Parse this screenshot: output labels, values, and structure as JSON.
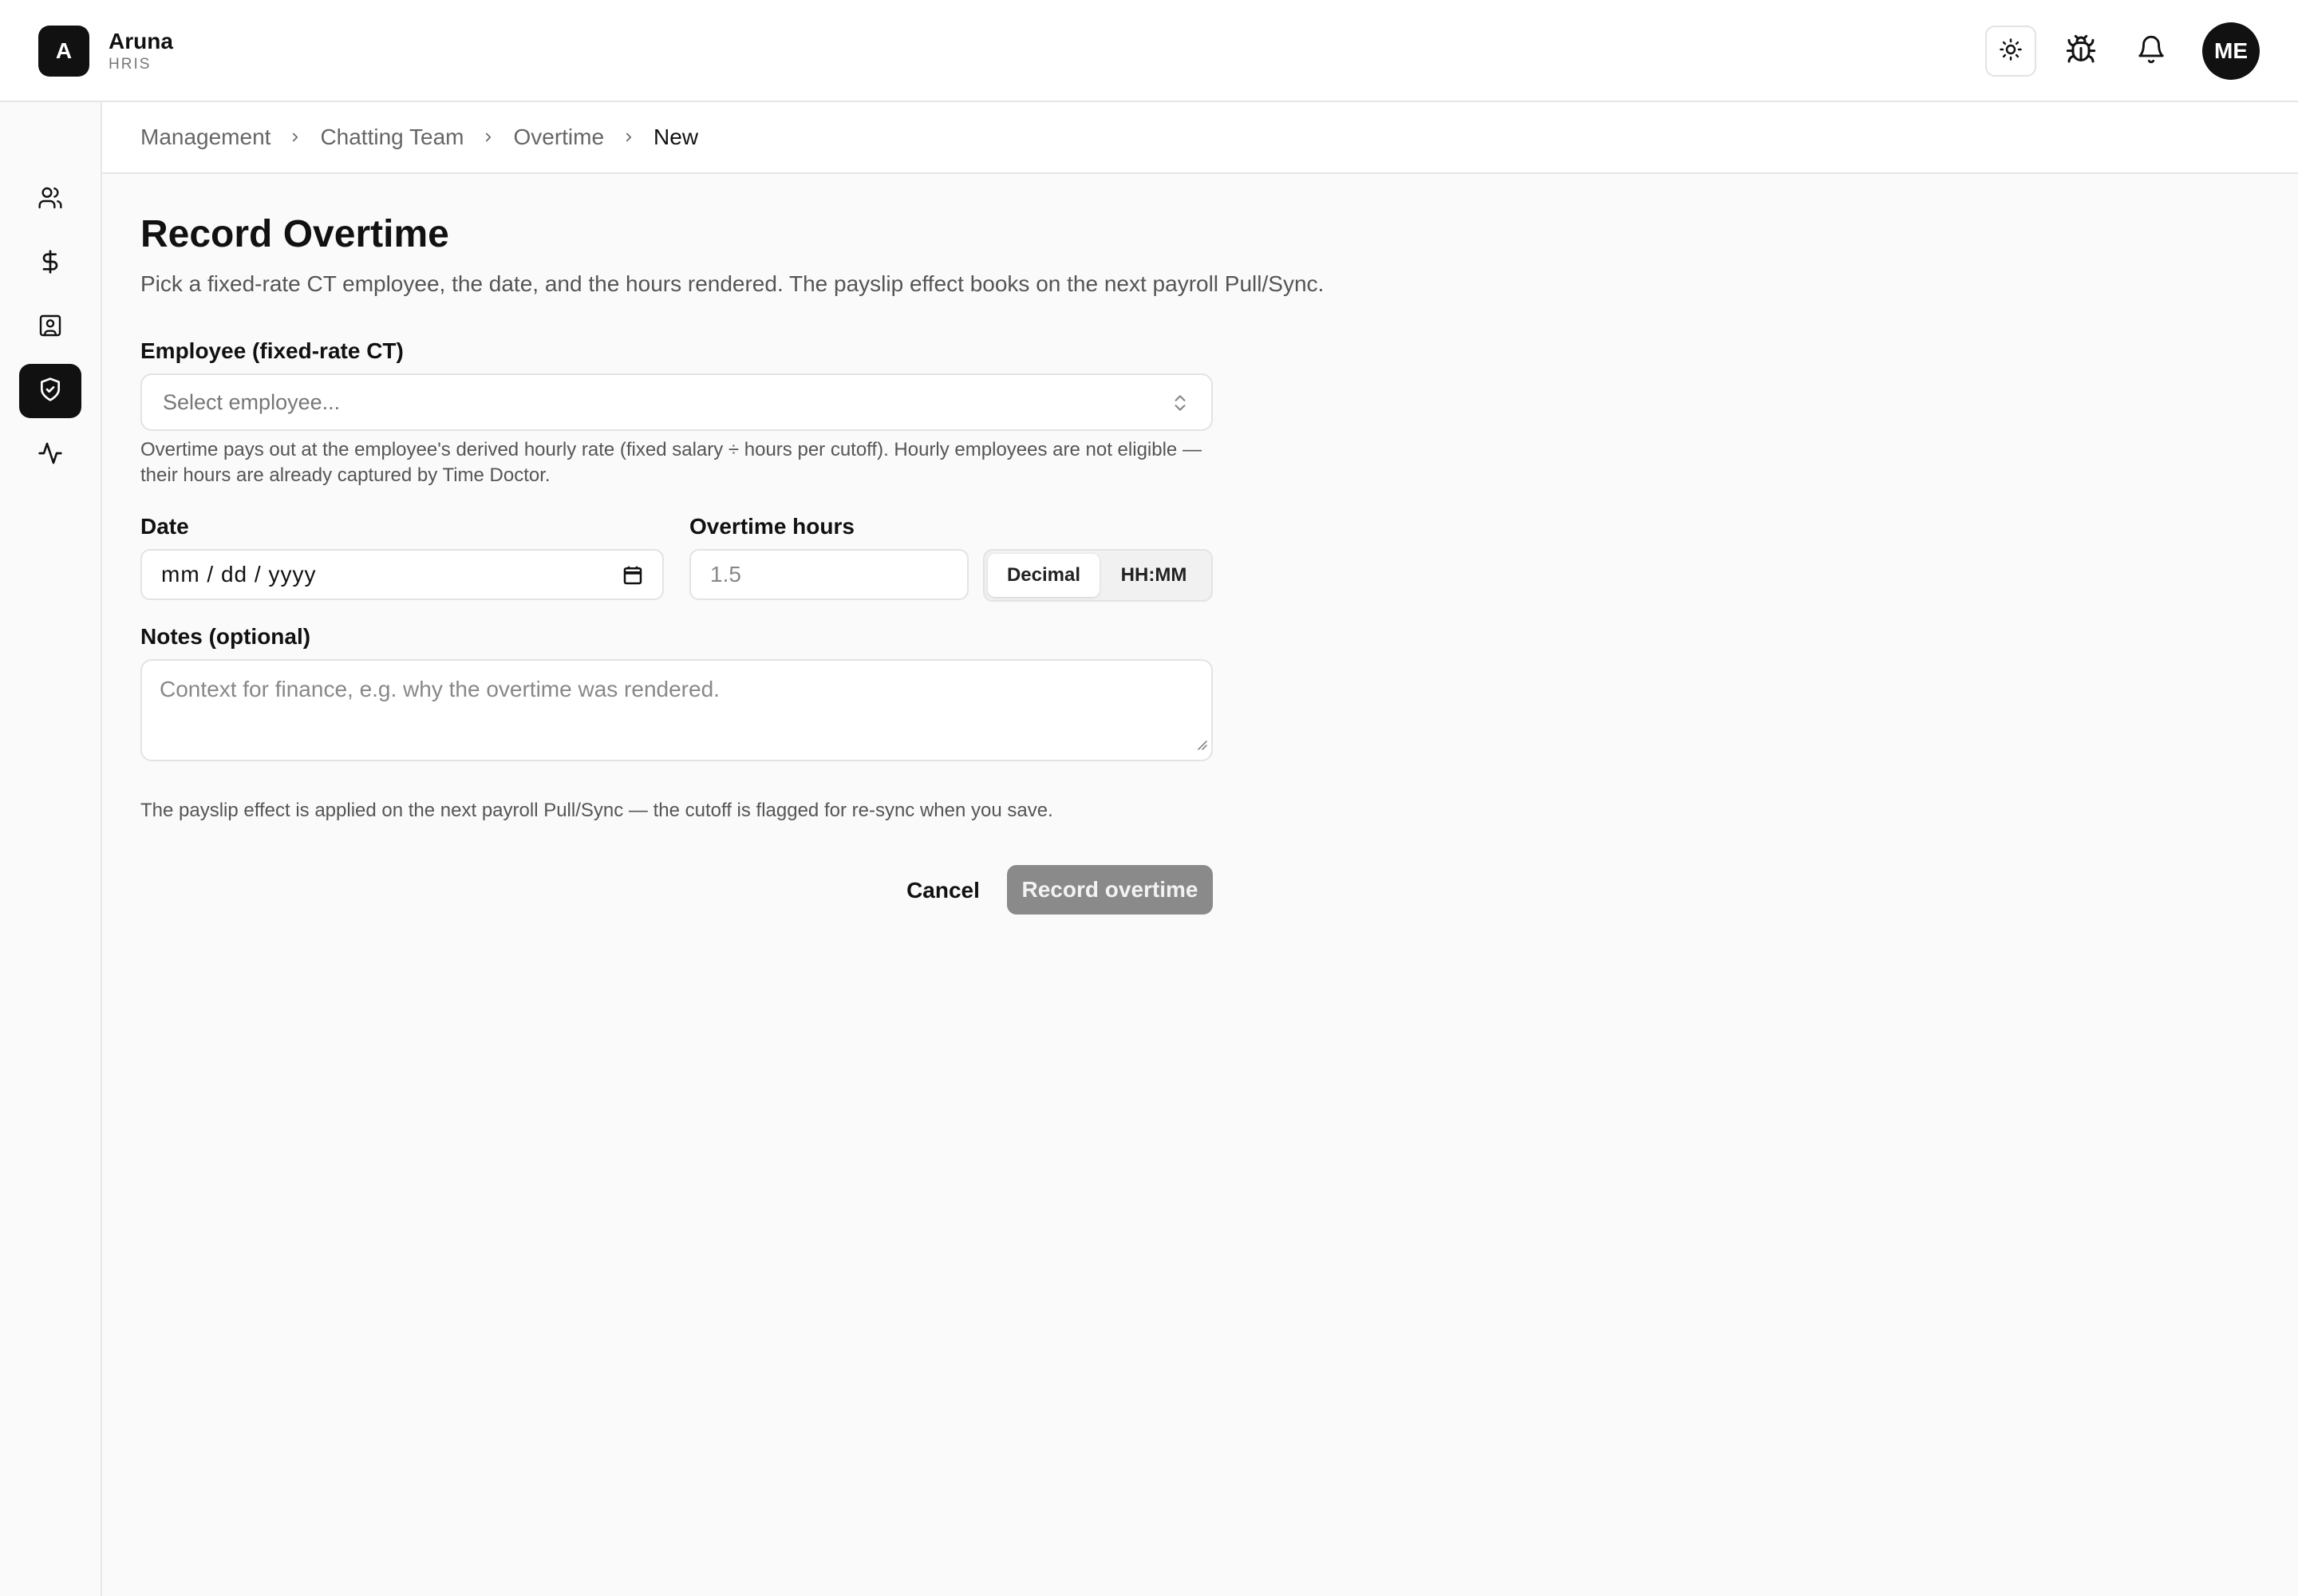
{
  "app": {
    "logo_letter": "A",
    "name": "Aruna",
    "subtitle": "HRIS"
  },
  "header": {
    "icons": [
      "sun-icon",
      "bug-icon",
      "bell-icon"
    ],
    "avatar_initials": "ME"
  },
  "sidebar": {
    "items": [
      {
        "icon": "users-icon",
        "active": false
      },
      {
        "icon": "dollar-icon",
        "active": false
      },
      {
        "icon": "contact-card-icon",
        "active": false
      },
      {
        "icon": "shield-check-icon",
        "active": true
      },
      {
        "icon": "activity-icon",
        "active": false
      }
    ]
  },
  "breadcrumb": [
    "Management",
    "Chatting Team",
    "Overtime",
    "New"
  ],
  "page": {
    "title": "Record Overtime",
    "description": "Pick a fixed-rate CT employee, the date, and the hours rendered. The payslip effect books on the next payroll Pull/Sync."
  },
  "form": {
    "employee": {
      "label": "Employee (fixed-rate CT)",
      "placeholder": "Select employee...",
      "help": "Overtime pays out at the employee's derived hourly rate (fixed salary ÷ hours per cutoff). Hourly employees are not eligible — their hours are already captured by Time Doctor."
    },
    "date": {
      "label": "Date",
      "value": "mm / dd / yyyy"
    },
    "hours": {
      "label": "Overtime hours",
      "placeholder": "1.5",
      "formats": [
        "Decimal",
        "HH:MM"
      ],
      "selected_format": "Decimal"
    },
    "notes": {
      "label": "Notes (optional)",
      "placeholder": "Context for finance, e.g. why the overtime was rendered."
    },
    "footnote": "The payslip effect is applied on the next payroll Pull/Sync — the cutoff is flagged for re-sync when you save.",
    "cancel_label": "Cancel",
    "submit_label": "Record overtime"
  },
  "colors": {
    "accent": "#111111",
    "submit_disabled": "#8a8a8a",
    "border": "#e3e3e3",
    "background": "#fafafa"
  }
}
